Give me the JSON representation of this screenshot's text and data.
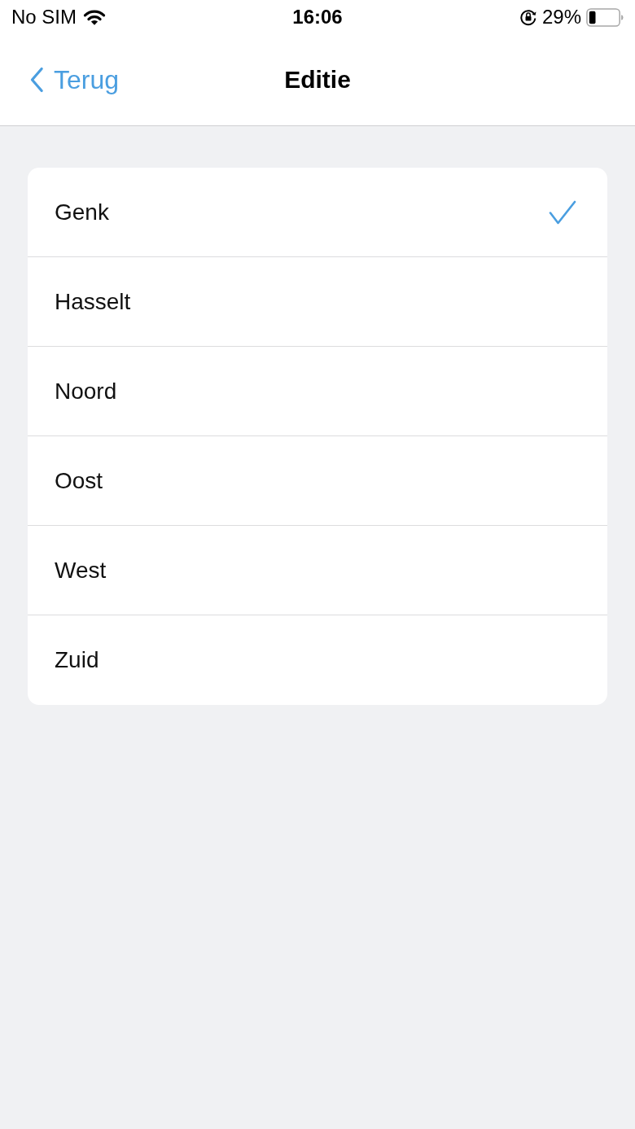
{
  "status_bar": {
    "carrier": "No SIM",
    "time": "16:06",
    "battery_percent": "29%"
  },
  "nav_bar": {
    "back": "Terug",
    "title": "Editie"
  },
  "options": [
    {
      "label": "Genk",
      "selected": true
    },
    {
      "label": "Hasselt",
      "selected": false
    },
    {
      "label": "Noord",
      "selected": false
    },
    {
      "label": "Oost",
      "selected": false
    },
    {
      "label": "West",
      "selected": false
    },
    {
      "label": "Zuid",
      "selected": false
    }
  ]
}
